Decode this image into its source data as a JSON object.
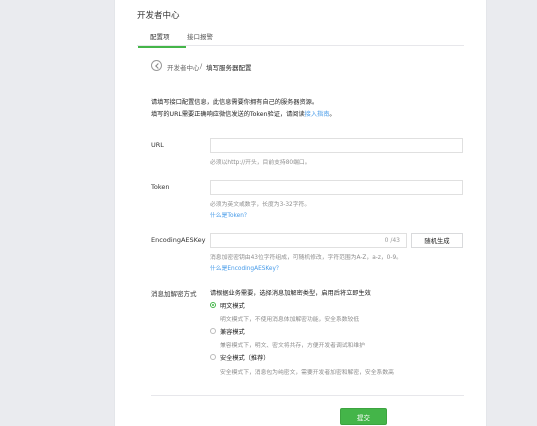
{
  "header": {
    "title": "开发者中心"
  },
  "tabs": [
    {
      "label": "配置项",
      "active": true
    },
    {
      "label": "接口报警",
      "active": false
    }
  ],
  "breadcrumb": {
    "parent": "开发者中心",
    "separator": "/",
    "current": "填写服务器配置"
  },
  "intro": {
    "line1": "请填写接口配置信息，此信息需要你拥有自己的服务器资源。",
    "line2_prefix": "填写的URL需要正确响应微信发送的Token验证，请阅读",
    "line2_link": "接入指南",
    "line2_suffix": "。"
  },
  "url": {
    "label": "URL",
    "value": "",
    "hint": "必须以http://开头，目前支持80端口。"
  },
  "token": {
    "label": "Token",
    "value": "",
    "hint": "必须为英文或数字，长度为3-32字符。",
    "help_link": "什么是Token？"
  },
  "aes": {
    "label": "EncodingAESKey",
    "value": "",
    "counter": "0 /43",
    "generate_label": "随机生成",
    "hint": "消息加密密钥由43位字符组成，可随机修改，字符范围为A-Z，a-z，0-9。",
    "help_link": "什么是EncodingAESKey？"
  },
  "encryption": {
    "label": "消息加解密方式",
    "description": "请根据业务需要，选择消息加解密类型，启用后将立即生效",
    "options": [
      {
        "label": "明文模式",
        "desc": "明文模式下，不使用消息体加解密功能，安全系数较低",
        "checked": true
      },
      {
        "label": "兼容模式",
        "desc": "兼容模式下，明文、密文将共存，方便开发者调试和维护",
        "checked": false
      },
      {
        "label": "安全模式（推荐）",
        "desc": "安全模式下，消息包为纯密文，需要开发者加密和解密，安全系数高",
        "checked": false
      }
    ]
  },
  "submit_label": "提交",
  "colors": {
    "accent": "#44b549",
    "link": "#459ae9",
    "background": "#eaebef"
  },
  "icons": {
    "back": "back-circle-icon"
  }
}
